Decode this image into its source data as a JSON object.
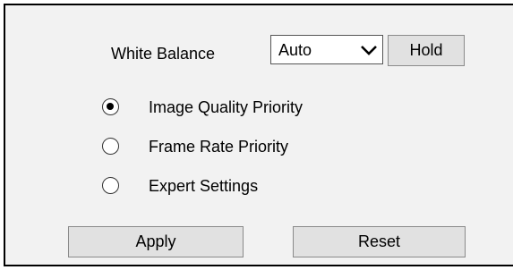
{
  "white_balance": {
    "label": "White Balance",
    "selected_value": "Auto",
    "hold_label": "Hold"
  },
  "priority_options": [
    {
      "label": "Image Quality Priority",
      "selected": true
    },
    {
      "label": "Frame Rate Priority",
      "selected": false
    },
    {
      "label": "Expert Settings",
      "selected": false
    }
  ],
  "actions": {
    "apply_label": "Apply",
    "reset_label": "Reset"
  }
}
